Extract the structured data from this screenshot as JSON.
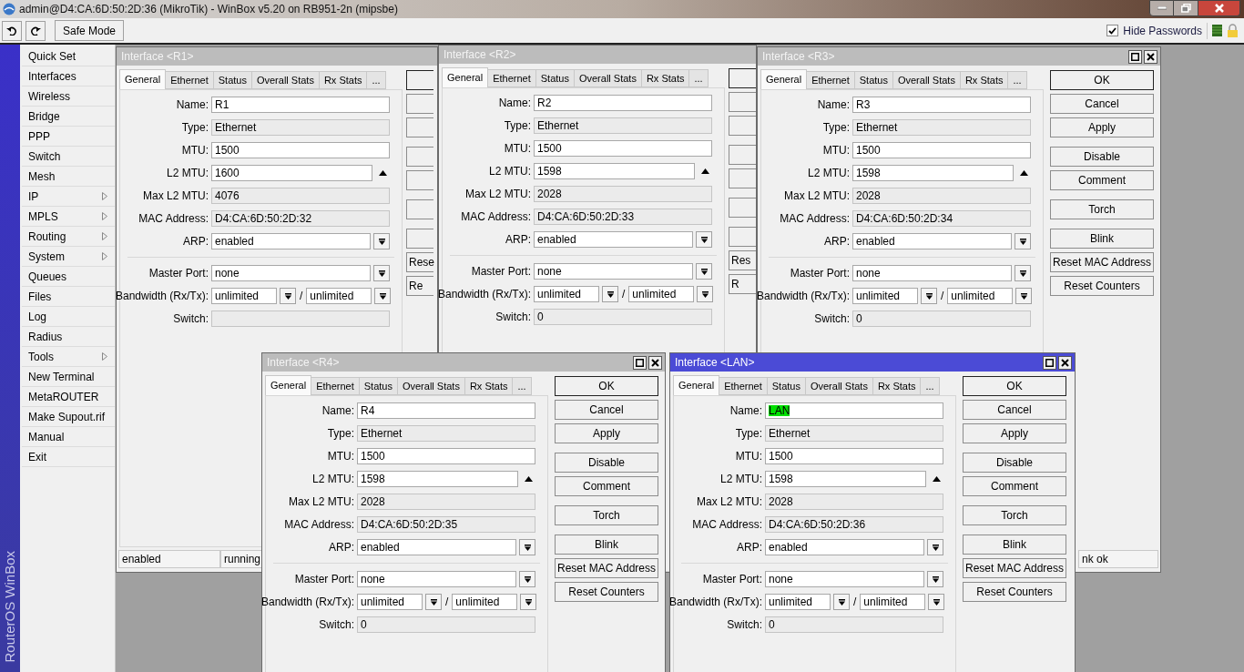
{
  "app": {
    "title": "admin@D4:CA:6D:50:2D:36 (MikroTik) - WinBox v5.20 on RB951-2n (mipsbe)"
  },
  "toolbar": {
    "safe_mode": "Safe Mode",
    "hide_passwords": {
      "label": "Hide Passwords",
      "checked": true
    }
  },
  "sidebar": {
    "brand": "RouterOS WinBox",
    "items": [
      {
        "label": "Quick Set",
        "submenu": false
      },
      {
        "label": "Interfaces",
        "submenu": false
      },
      {
        "label": "Wireless",
        "submenu": false
      },
      {
        "label": "Bridge",
        "submenu": false
      },
      {
        "label": "PPP",
        "submenu": false
      },
      {
        "label": "Switch",
        "submenu": false
      },
      {
        "label": "Mesh",
        "submenu": false
      },
      {
        "label": "IP",
        "submenu": true
      },
      {
        "label": "MPLS",
        "submenu": true
      },
      {
        "label": "Routing",
        "submenu": true
      },
      {
        "label": "System",
        "submenu": true
      },
      {
        "label": "Queues",
        "submenu": false
      },
      {
        "label": "Files",
        "submenu": false
      },
      {
        "label": "Log",
        "submenu": false
      },
      {
        "label": "Radius",
        "submenu": false
      },
      {
        "label": "Tools",
        "submenu": true
      },
      {
        "label": "New Terminal",
        "submenu": false
      },
      {
        "label": "MetaROUTER",
        "submenu": false
      },
      {
        "label": "Make Supout.rif",
        "submenu": false
      },
      {
        "label": "Manual",
        "submenu": false
      },
      {
        "label": "Exit",
        "submenu": false
      }
    ]
  },
  "windows": [
    {
      "title": "Interface <R1>",
      "active": false,
      "buttons_clipped": true,
      "tabs": [
        {
          "label": "General",
          "selected": true
        },
        {
          "label": "Ethernet",
          "selected": false
        },
        {
          "label": "Status",
          "selected": false
        },
        {
          "label": "Overall Stats",
          "selected": false
        },
        {
          "label": "Rx Stats",
          "selected": false
        },
        {
          "label": "...",
          "selected": false
        }
      ],
      "fields": [
        {
          "kind": "text",
          "label": "Name:",
          "value": "R1"
        },
        {
          "kind": "readonly",
          "label": "Type:",
          "value": "Ethernet"
        },
        {
          "kind": "text",
          "label": "MTU:",
          "value": "1500"
        },
        {
          "kind": "spin",
          "label": "L2 MTU:",
          "value": "1600"
        },
        {
          "kind": "readonly",
          "label": "Max L2 MTU:",
          "value": "4076"
        },
        {
          "kind": "readonly",
          "label": "MAC Address:",
          "value": "D4:CA:6D:50:2D:32"
        },
        {
          "kind": "select",
          "label": "ARP:",
          "value": "enabled"
        },
        {
          "kind": "separator"
        },
        {
          "kind": "select",
          "label": "Master Port:",
          "value": "none"
        },
        {
          "kind": "range",
          "label": "Bandwidth (Rx/Tx):",
          "values": [
            "unlimited",
            "unlimited"
          ],
          "divider": "/"
        },
        {
          "kind": "readonly",
          "label": "Switch:"
        }
      ],
      "buttons": [
        {
          "label": "Rese"
        },
        {
          "label": "Re"
        }
      ],
      "status_bar": [
        "enabled",
        "running"
      ]
    },
    {
      "title": "Interface <R2>",
      "active": false,
      "buttons_clipped": true,
      "tabs": [
        {
          "label": "General",
          "selected": true
        },
        {
          "label": "Ethernet",
          "selected": false
        },
        {
          "label": "Status",
          "selected": false
        },
        {
          "label": "Overall Stats",
          "selected": false
        },
        {
          "label": "Rx Stats",
          "selected": false
        },
        {
          "label": "...",
          "selected": false
        }
      ],
      "fields": [
        {
          "kind": "text",
          "label": "Name:",
          "value": "R2"
        },
        {
          "kind": "readonly",
          "label": "Type:",
          "value": "Ethernet"
        },
        {
          "kind": "text",
          "label": "MTU:",
          "value": "1500"
        },
        {
          "kind": "spin",
          "label": "L2 MTU:",
          "value": "1598"
        },
        {
          "kind": "readonly",
          "label": "Max L2 MTU:",
          "value": "2028"
        },
        {
          "kind": "readonly",
          "label": "MAC Address:",
          "value": "D4:CA:6D:50:2D:33"
        },
        {
          "kind": "select",
          "label": "ARP:",
          "value": "enabled"
        },
        {
          "kind": "separator"
        },
        {
          "kind": "select",
          "label": "Master Port:",
          "value": "none"
        },
        {
          "kind": "range",
          "label": "Bandwidth (Rx/Tx):",
          "values": [
            "unlimited",
            "unlimited"
          ],
          "divider": "/"
        },
        {
          "kind": "readonly",
          "label": "Switch:",
          "value": "0"
        }
      ],
      "buttons": [
        {
          "label": "Res"
        },
        {
          "label": "R"
        }
      ]
    },
    {
      "title": "Interface <R3>",
      "active": false,
      "buttons_clipped": false,
      "tabs": [
        {
          "label": "General",
          "selected": true
        },
        {
          "label": "Ethernet",
          "selected": false
        },
        {
          "label": "Status",
          "selected": false
        },
        {
          "label": "Overall Stats",
          "selected": false
        },
        {
          "label": "Rx Stats",
          "selected": false
        },
        {
          "label": "...",
          "selected": false
        }
      ],
      "fields": [
        {
          "kind": "text",
          "label": "Name:",
          "value": "R3"
        },
        {
          "kind": "readonly",
          "label": "Type:",
          "value": "Ethernet"
        },
        {
          "kind": "text",
          "label": "MTU:",
          "value": "1500"
        },
        {
          "kind": "spin",
          "label": "L2 MTU:",
          "value": "1598"
        },
        {
          "kind": "readonly",
          "label": "Max L2 MTU:",
          "value": "2028"
        },
        {
          "kind": "readonly",
          "label": "MAC Address:",
          "value": "D4:CA:6D:50:2D:34"
        },
        {
          "kind": "select",
          "label": "ARP:",
          "value": "enabled"
        },
        {
          "kind": "separator"
        },
        {
          "kind": "select",
          "label": "Master Port:",
          "value": "none"
        },
        {
          "kind": "range",
          "label": "Bandwidth (Rx/Tx):",
          "values": [
            "unlimited",
            "unlimited"
          ],
          "divider": "/"
        },
        {
          "kind": "readonly",
          "label": "Switch:",
          "value": "0"
        }
      ],
      "buttons": [
        {
          "label": "OK"
        },
        {
          "label": "Cancel"
        },
        {
          "label": "Apply"
        },
        {
          "label": "Disable"
        },
        {
          "label": "Comment"
        },
        {
          "label": "Torch"
        },
        {
          "label": "Blink"
        },
        {
          "label": "Reset MAC Address"
        },
        {
          "label": "Reset Counters"
        }
      ],
      "status_bar": [
        "nk ok"
      ]
    },
    {
      "title": "Interface <R4>",
      "active": false,
      "buttons_clipped": false,
      "tabs": [
        {
          "label": "General",
          "selected": true
        },
        {
          "label": "Ethernet",
          "selected": false
        },
        {
          "label": "Status",
          "selected": false
        },
        {
          "label": "Overall Stats",
          "selected": false
        },
        {
          "label": "Rx Stats",
          "selected": false
        },
        {
          "label": "...",
          "selected": false
        }
      ],
      "fields": [
        {
          "kind": "text",
          "label": "Name:",
          "value": "R4"
        },
        {
          "kind": "readonly",
          "label": "Type:",
          "value": "Ethernet"
        },
        {
          "kind": "text",
          "label": "MTU:",
          "value": "1500"
        },
        {
          "kind": "spin",
          "label": "L2 MTU:",
          "value": "1598"
        },
        {
          "kind": "readonly",
          "label": "Max L2 MTU:",
          "value": "2028"
        },
        {
          "kind": "readonly",
          "label": "MAC Address:",
          "value": "D4:CA:6D:50:2D:35"
        },
        {
          "kind": "select",
          "label": "ARP:",
          "value": "enabled"
        },
        {
          "kind": "separator"
        },
        {
          "kind": "select",
          "label": "Master Port:",
          "value": "none"
        },
        {
          "kind": "range",
          "label": "Bandwidth (Rx/Tx):",
          "values": [
            "unlimited",
            "unlimited"
          ],
          "divider": "/"
        },
        {
          "kind": "readonly",
          "label": "Switch:",
          "value": "0"
        }
      ],
      "buttons": [
        {
          "label": "OK"
        },
        {
          "label": "Cancel"
        },
        {
          "label": "Apply"
        },
        {
          "label": "Disable"
        },
        {
          "label": "Comment"
        },
        {
          "label": "Torch"
        },
        {
          "label": "Blink"
        },
        {
          "label": "Reset MAC Address"
        },
        {
          "label": "Reset Counters"
        }
      ]
    },
    {
      "title": "Interface <LAN>",
      "active": true,
      "buttons_clipped": false,
      "tabs": [
        {
          "label": "General",
          "selected": true
        },
        {
          "label": "Ethernet",
          "selected": false
        },
        {
          "label": "Status",
          "selected": false
        },
        {
          "label": "Overall Stats",
          "selected": false
        },
        {
          "label": "Rx Stats",
          "selected": false
        },
        {
          "label": "...",
          "selected": false
        }
      ],
      "fields": [
        {
          "kind": "text",
          "label": "Name:",
          "value": "LAN",
          "text_selected": true
        },
        {
          "kind": "readonly",
          "label": "Type:",
          "value": "Ethernet"
        },
        {
          "kind": "text",
          "label": "MTU:",
          "value": "1500"
        },
        {
          "kind": "spin",
          "label": "L2 MTU:",
          "value": "1598"
        },
        {
          "kind": "readonly",
          "label": "Max L2 MTU:",
          "value": "2028"
        },
        {
          "kind": "readonly",
          "label": "MAC Address:",
          "value": "D4:CA:6D:50:2D:36"
        },
        {
          "kind": "select",
          "label": "ARP:",
          "value": "enabled"
        },
        {
          "kind": "separator"
        },
        {
          "kind": "select",
          "label": "Master Port:",
          "value": "none"
        },
        {
          "kind": "range",
          "label": "Bandwidth (Rx/Tx):",
          "values": [
            "unlimited",
            "unlimited"
          ],
          "divider": "/"
        },
        {
          "kind": "readonly",
          "label": "Switch:",
          "value": "0"
        }
      ],
      "buttons": [
        {
          "label": "OK"
        },
        {
          "label": "Cancel"
        },
        {
          "label": "Apply"
        },
        {
          "label": "Disable"
        },
        {
          "label": "Comment"
        },
        {
          "label": "Torch"
        },
        {
          "label": "Blink"
        },
        {
          "label": "Reset MAC Address"
        },
        {
          "label": "Reset Counters"
        }
      ]
    }
  ]
}
